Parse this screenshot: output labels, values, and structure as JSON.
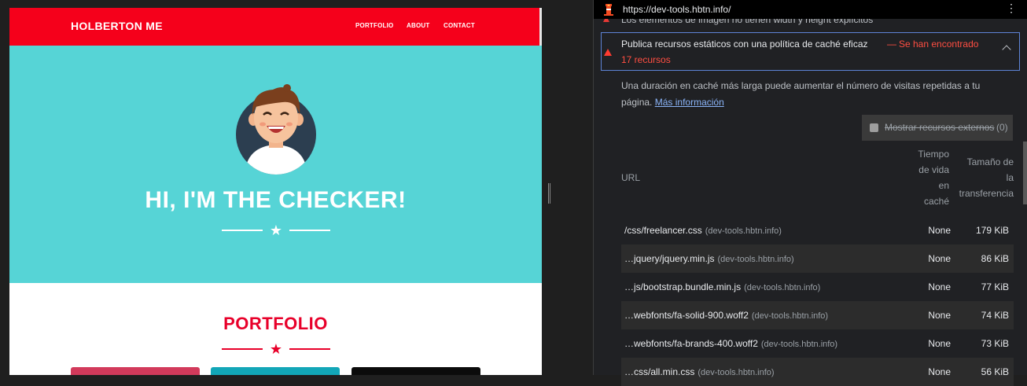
{
  "site": {
    "brand": "HOLBERTON ME",
    "nav": [
      "PORTFOLIO",
      "ABOUT",
      "CONTACT"
    ],
    "hero_title": "HI, I'M THE CHECKER!",
    "section_title": "PORTFOLIO",
    "colors": {
      "nav": "#f5001b",
      "hero": "#56d4d6",
      "accent": "#e8002a"
    },
    "cards_colors": [
      "#d23a5b",
      "#12a6b7",
      "#0b0b0b"
    ]
  },
  "devtools": {
    "url": "https://dev-tools.hbtn.info/",
    "previous_audit": "Los elementos de imagen no tienen width y height explícitos",
    "audit": {
      "title": "Publica recursos estáticos con una política de caché eficaz",
      "separator": "—",
      "found_line1": "Se han encontrado",
      "found_line2": "17 recursos"
    },
    "description": "Una duración en caché más larga puede aumentar el número de visitas repetidas a tu página.",
    "learn_more": "Más información",
    "external_toggle": {
      "label": "Mostrar recursos externos",
      "count": "(0)"
    },
    "columns": {
      "url": "URL",
      "ttl": [
        "Tiempo",
        "de vida",
        "en",
        "caché"
      ],
      "size": [
        "Tamaño de",
        "la",
        "transferencia"
      ]
    },
    "rows": [
      {
        "url": "/css/freelancer.css",
        "host": "(dev-tools.hbtn.info)",
        "ttl": "None",
        "size": "179 KiB"
      },
      {
        "url": "…jquery/jquery.min.js",
        "host": "(dev-tools.hbtn.info)",
        "ttl": "None",
        "size": "86 KiB"
      },
      {
        "url": "…js/bootstrap.bundle.min.js",
        "host": "(dev-tools.hbtn.info)",
        "ttl": "None",
        "size": "77 KiB"
      },
      {
        "url": "…webfonts/fa-solid-900.woff2",
        "host": "(dev-tools.hbtn.info)",
        "ttl": "None",
        "size": "74 KiB"
      },
      {
        "url": "…webfonts/fa-brands-400.woff2",
        "host": "(dev-tools.hbtn.info)",
        "ttl": "None",
        "size": "73 KiB"
      },
      {
        "url": "…css/all.min.css",
        "host": "(dev-tools.hbtn.info)",
        "ttl": "None",
        "size": "56 KiB"
      }
    ]
  }
}
